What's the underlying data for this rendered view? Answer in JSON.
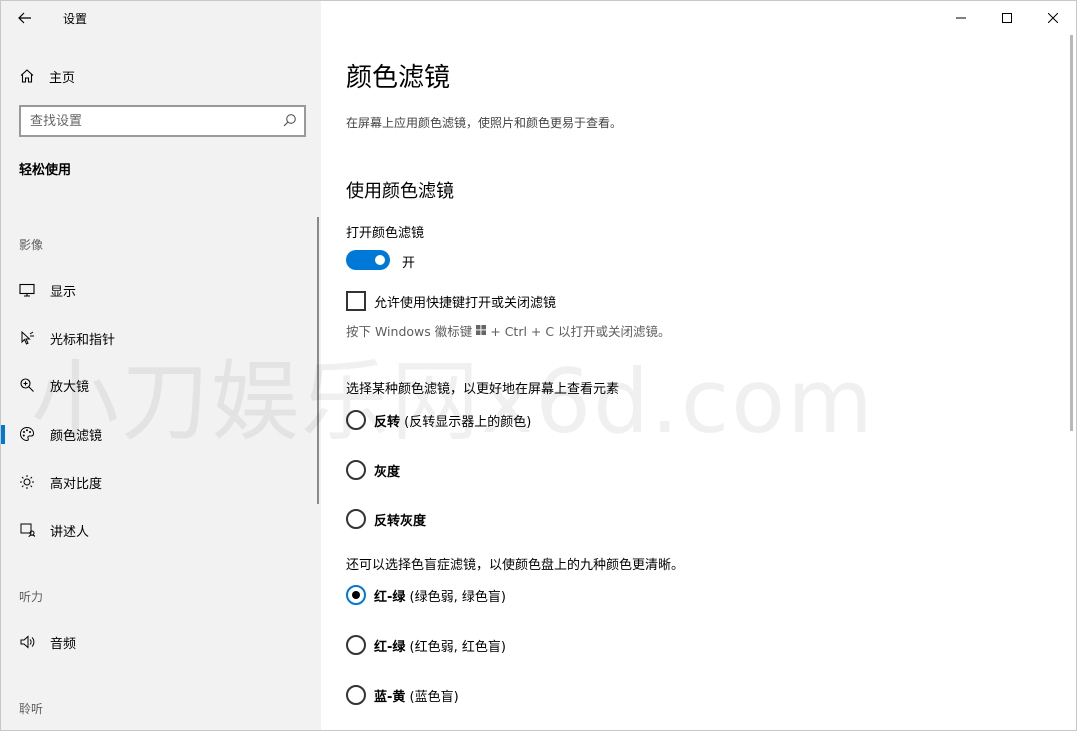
{
  "window": {
    "title": "设置"
  },
  "sidebar": {
    "home_label": "主页",
    "search_placeholder": "查找设置",
    "section_label": "轻松使用",
    "groups": {
      "vision": "影像",
      "hearing": "听力",
      "interaction": "聆听"
    },
    "items": [
      {
        "label": "显示",
        "icon": "monitor-icon"
      },
      {
        "label": "光标和指针",
        "icon": "pointer-icon"
      },
      {
        "label": "放大镜",
        "icon": "magnifier-icon"
      },
      {
        "label": "颜色滤镜",
        "icon": "palette-icon",
        "selected": true
      },
      {
        "label": "高对比度",
        "icon": "brightness-icon"
      },
      {
        "label": "讲述人",
        "icon": "narrator-icon"
      },
      {
        "label": "音频",
        "icon": "speaker-icon"
      }
    ]
  },
  "main": {
    "title": "颜色滤镜",
    "description": "在屏幕上应用颜色滤镜，使照片和颜色更易于查看。",
    "section_title": "使用颜色滤镜",
    "toggle_label": "打开颜色滤镜",
    "toggle_state": "开",
    "toggle_on": true,
    "shortcut_checkbox_label": "允许使用快捷键打开或关闭滤镜",
    "shortcut_checked": false,
    "hint_prefix": "按下 Windows 徽标键",
    "hint_suffix": "+ Ctrl + C 以打开或关闭滤镜。",
    "choose_filter_label": "选择某种颜色滤镜，以更好地在屏幕上查看元素",
    "filters": [
      {
        "bold": "反转",
        "note": " (反转显示器上的颜色)",
        "checked": false
      },
      {
        "bold": "灰度",
        "note": "",
        "checked": false
      },
      {
        "bold": "反转灰度",
        "note": "",
        "checked": false
      }
    ],
    "colorblind_label": "还可以选择色盲症滤镜，以使颜色盘上的九种颜色更清晰。",
    "colorblind_filters": [
      {
        "bold": "红-绿",
        "note": " (绿色弱, 绿色盲)",
        "checked": true
      },
      {
        "bold": "红-绿",
        "note": " (红色弱, 红色盲)",
        "checked": false
      },
      {
        "bold": "蓝-黄",
        "note": " (蓝色盲)",
        "checked": false
      }
    ]
  },
  "watermark": "小刀娱乐网x6d.com",
  "colors": {
    "accent": "#0078d7",
    "sidebar_bg": "#f2f2f2"
  }
}
